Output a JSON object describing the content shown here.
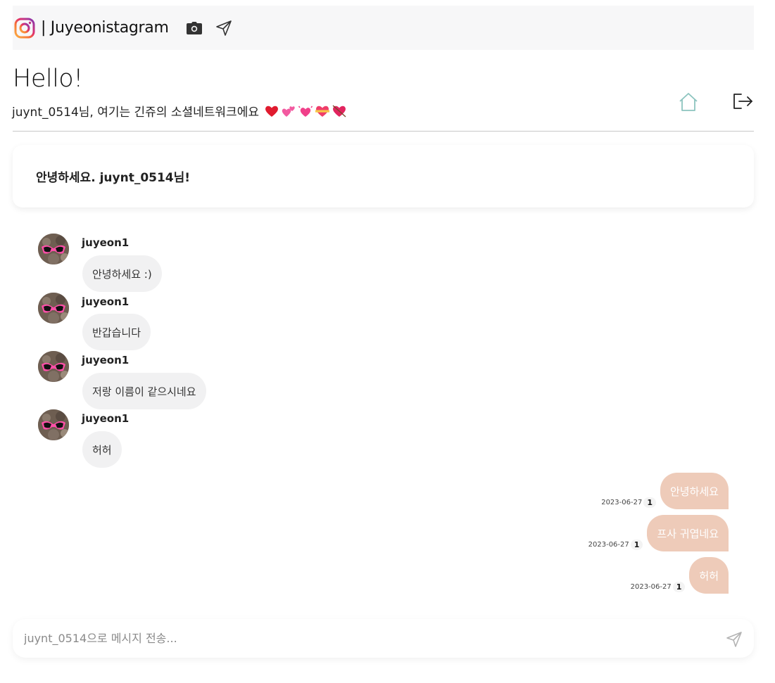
{
  "header": {
    "brand": "| Juyeonistagram"
  },
  "hero": {
    "title": "Hello!",
    "subtitle": "juynt_0514님, 여기는 긴쥬의 소셜네트워크에요"
  },
  "greeting": "안녕하세요. juynt_0514님!",
  "incoming": [
    {
      "sender": "juyeon1",
      "text": "안녕하세요 :)"
    },
    {
      "sender": "juyeon1",
      "text": "반갑습니다"
    },
    {
      "sender": "juyeon1",
      "text": "저랑 이름이 같으시네요"
    },
    {
      "sender": "juyeon1",
      "text": "허허"
    }
  ],
  "outgoing": [
    {
      "text": "안녕하세요",
      "date": "2023-06-27",
      "unread": "1"
    },
    {
      "text": "프사 귀엽네요",
      "date": "2023-06-27",
      "unread": "1"
    },
    {
      "text": "허허",
      "date": "2023-06-27",
      "unread": "1"
    }
  ],
  "composer": {
    "placeholder": "juynt_0514으로 메시지 전송..."
  },
  "colors": {
    "outgoing_bubble": "#eecbb9",
    "incoming_bubble": "#f1f1f2",
    "home_icon": "#8cc4bf"
  },
  "icons": [
    "instagram-logo-icon",
    "camera-icon",
    "send-icon",
    "home-icon",
    "logout-icon"
  ]
}
